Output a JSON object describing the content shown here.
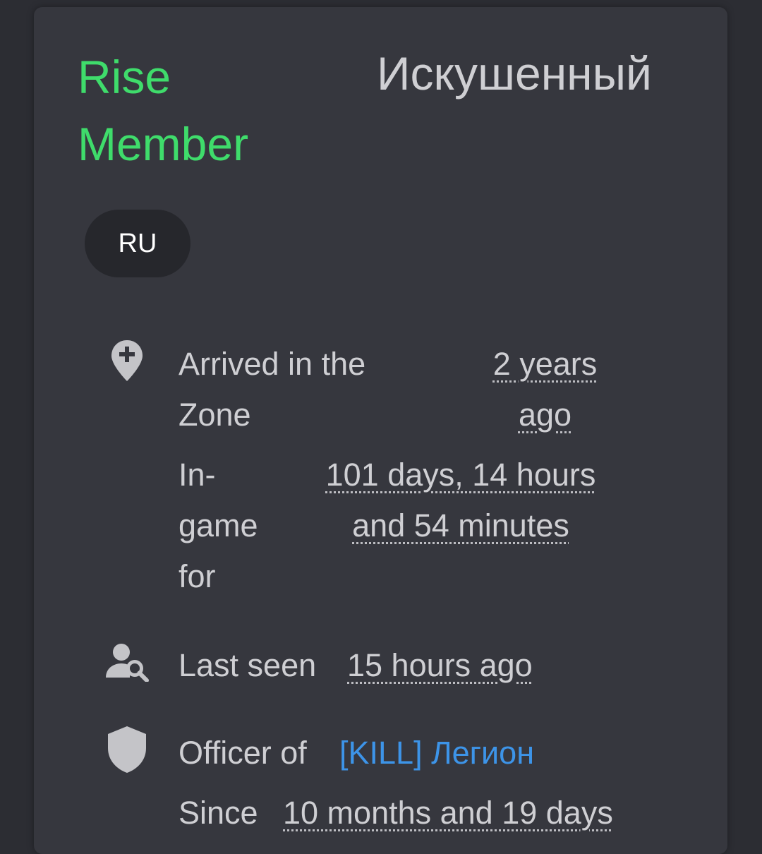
{
  "profile": {
    "rank": "Rise Member",
    "title": "Искушенный",
    "language_badge": "RU"
  },
  "stats": {
    "arrived": {
      "label": "Arrived in the Zone",
      "value": "2 years ago",
      "icon": "map-marker-plus-icon"
    },
    "ingame": {
      "label": "In-game for",
      "value": "101 days, 14 hours and 54 minutes"
    },
    "last_seen": {
      "label": "Last seen",
      "value": "15 hours ago",
      "icon": "user-search-icon"
    },
    "officer": {
      "label": "Officer of",
      "clan": "[KILL] Легион",
      "icon": "shield-icon"
    },
    "since": {
      "label": "Since",
      "value": "10 months and 19 days"
    }
  },
  "colors": {
    "rank_green": "#3fdc6b",
    "link_blue": "#3d94e8",
    "card_bg": "#36373e",
    "page_bg": "#2c2d33"
  }
}
